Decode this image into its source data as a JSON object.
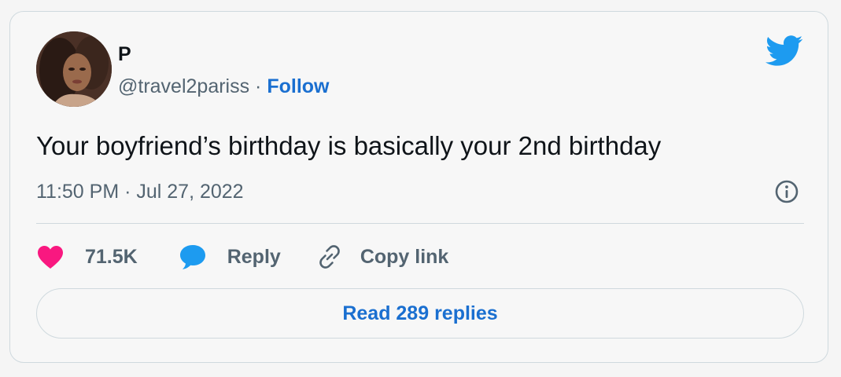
{
  "tweet": {
    "author_name": "P",
    "handle": "@travel2pariss",
    "separator": " · ",
    "follow_label": "Follow",
    "text": "Your boyfriend’s birthday is basically your 2nd birthday",
    "timestamp": "11:50 PM · Jul 27, 2022",
    "like_count": "71.5K",
    "reply_label": "Reply",
    "copy_link_label": "Copy link",
    "read_replies_label": "Read 289 replies"
  },
  "colors": {
    "brand_blue": "#1d9bf0",
    "link_blue": "#1a6fd0",
    "like_pink": "#f91880",
    "text_primary": "#0f1419",
    "text_secondary": "#536471",
    "border": "#cfd9de"
  },
  "icons": {
    "brand": "twitter-bird-icon",
    "info": "info-icon",
    "like": "heart-icon",
    "reply": "speech-bubble-icon",
    "copy_link": "link-icon"
  }
}
